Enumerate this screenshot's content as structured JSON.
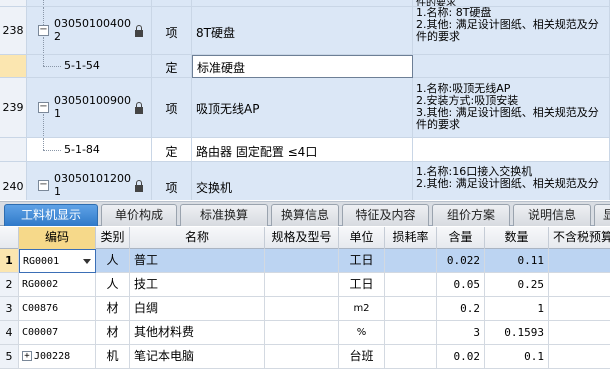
{
  "top_rows": [
    {
      "num": "238",
      "code": [
        "03050100400",
        "2"
      ],
      "unit_type": "项",
      "name": "8T硬盘",
      "features": [
        "1.名称: 8T硬盘",
        "2.其他: 满足设计图纸、相关规范及分",
        "件的要求"
      ]
    },
    {
      "num": "",
      "code": [
        "5-1-54"
      ],
      "unit_type": "定",
      "name": "标准硬盘",
      "features": []
    },
    {
      "num": "239",
      "code": [
        "03050100900",
        "1"
      ],
      "unit_type": "项",
      "name": "吸顶无线AP",
      "features": [
        "1.名称:吸顶无线AP",
        "2.安装方式:吸顶安装",
        "3.其他: 满足设计图纸、相关规范及分",
        "件的要求"
      ]
    },
    {
      "num": "",
      "code": [
        "5-1-84"
      ],
      "unit_type": "定",
      "name": "路由器 固定配置 ≤4口",
      "features": []
    },
    {
      "num": "240",
      "code": [
        "03050101200",
        "1"
      ],
      "unit_type": "项",
      "name": "交换机",
      "features": [
        "1.名称:16口接入交换机",
        "2.其他: 满足设计图纸、相关规范及分"
      ]
    }
  ],
  "top_partial_text": "件的要求",
  "tabs": [
    "工料机显示",
    "单价构成",
    "标准换算",
    "换算信息",
    "特征及内容",
    "组价方案",
    "说明信息",
    "显"
  ],
  "active_tab": 0,
  "columns": [
    "",
    "编码",
    "类别",
    "名称",
    "规格及型号",
    "单位",
    "损耗率",
    "含量",
    "数量",
    "不含税预算"
  ],
  "rows": [
    {
      "no": "1",
      "code": "RG0001",
      "type": "人",
      "name": "普工",
      "spec": "",
      "unit": "工日",
      "loss": "",
      "content": "0.022",
      "qty": "0.11",
      "price": ""
    },
    {
      "no": "2",
      "code": "RG0002",
      "type": "人",
      "name": "技工",
      "spec": "",
      "unit": "工日",
      "loss": "",
      "content": "0.05",
      "qty": "0.25",
      "price": ""
    },
    {
      "no": "3",
      "code": "C00876",
      "type": "材",
      "name": "白绸",
      "spec": "",
      "unit": "m2",
      "loss": "",
      "content": "0.2",
      "qty": "1",
      "price": ""
    },
    {
      "no": "4",
      "code": "C00007",
      "type": "材",
      "name": "其他材料费",
      "spec": "",
      "unit": "%",
      "loss": "",
      "content": "3",
      "qty": "0.1593",
      "price": ""
    },
    {
      "no": "5",
      "code": "J00228",
      "type": "机",
      "name": "笔记本电脑",
      "spec": "",
      "unit": "台班",
      "loss": "",
      "content": "0.02",
      "qty": "0.1",
      "price": ""
    }
  ],
  "icons": {
    "lock": "lock-icon",
    "collapse": "collapse-icon",
    "expand": "expand-icon",
    "dropdown": "dropdown-arrow-icon"
  },
  "colors": {
    "active_tab": "#2f79c9",
    "selected_row": "#bcd4f2",
    "header_highlight": "#f6d98a",
    "row_blue": "#dbe7f6"
  }
}
